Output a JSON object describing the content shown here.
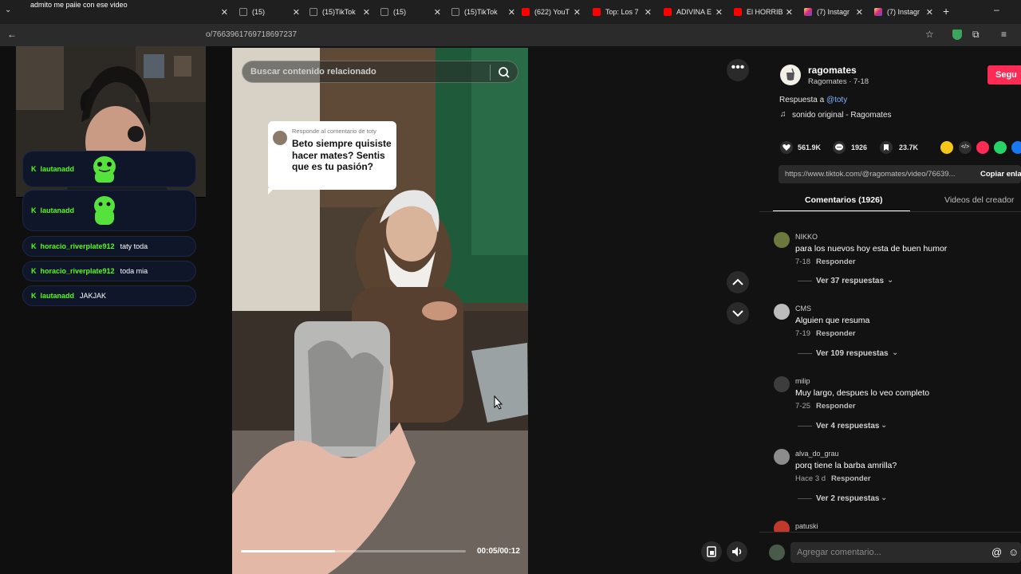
{
  "browser": {
    "top_text": "admito me paiie con ese video",
    "tabs": [
      {
        "label": "",
        "icon": "tiktok-icon"
      },
      {
        "label": "(15)",
        "icon": "tiktok-icon"
      },
      {
        "label": "(15)TikTok",
        "icon": "tiktok-icon"
      },
      {
        "label": "(15)",
        "icon": "tiktok-icon"
      },
      {
        "label": "(15)TikTok",
        "icon": "tiktok-icon"
      },
      {
        "label": "(622) YouT",
        "icon": "youtube-icon"
      },
      {
        "label": "Top: Los 7",
        "icon": "youtube-icon"
      },
      {
        "label": "ADIVINA E",
        "icon": "youtube-icon"
      },
      {
        "label": "El HORRIB",
        "icon": "youtube-icon"
      },
      {
        "label": "(7) Instagr",
        "icon": "instagram-icon"
      },
      {
        "label": "(7) Instagr",
        "icon": "instagram-icon"
      }
    ],
    "url": "o/7663961769718697237",
    "new_tab": "+",
    "minimize": "–"
  },
  "chat": [
    {
      "user": "lautanadd",
      "message": "",
      "emote": "green-emote"
    },
    {
      "user": "lautanadd",
      "message": "",
      "emote": "green-emote"
    },
    {
      "user": "horacio_riverplate912",
      "message": "taty toda"
    },
    {
      "user": "horacio_riverplate912",
      "message": "toda mia"
    },
    {
      "user": "lautanadd",
      "message": "JAKJAK"
    }
  ],
  "video": {
    "search_placeholder": "Buscar contenido relacionado",
    "reply_header": "Responde al comentario de toty",
    "reply_text": "Beto siempre quisiste hacer mates? Sentis que es tu pasión?",
    "time": "00:05/00:12",
    "progress": 0.42
  },
  "creator": {
    "username": "ragomates",
    "display": "Ragomates · 7-18",
    "follow": "Segu",
    "reply_prefix": "Respuesta a ",
    "reply_to": "@toty",
    "sound": "sonido original - Ragomates",
    "likes": "561.9K",
    "comments": "1926",
    "saves": "23.7K",
    "link": "https://www.tiktok.com/@ragomates/video/76639...",
    "copy": "Copiar enla"
  },
  "tabs": {
    "comments": "Comentarios (1926)",
    "videos": "Videos del creador"
  },
  "comments": [
    {
      "name": "NIKKO",
      "text": "para los nuevos hoy esta de buen humor",
      "date": "7-18",
      "reply": "Responder",
      "more": "Ver 37 respuestas"
    },
    {
      "name": "CMS",
      "text": "Alguien que resuma",
      "date": "7-19",
      "reply": "Responder",
      "more": "Ver 109 respuestas"
    },
    {
      "name": "milip",
      "text": "Muy largo, despues lo veo completo",
      "date": "7-25",
      "reply": "Responder",
      "more": "Ver 4 respuestas"
    },
    {
      "name": "alva_do_grau",
      "text": "porq tiene la barba amrilla?",
      "date": "Hace 3 d",
      "reply": "Responder",
      "more": "Ver 2 respuestas"
    },
    {
      "name": "patuski",
      "text": "",
      "date": "",
      "reply": "",
      "more": ""
    }
  ],
  "composer": {
    "placeholder": "Agregar comentario...",
    "at": "@"
  },
  "colors": {
    "accent": "#fe2c55",
    "link": "#7ab6ff",
    "kick_green": "#53fc18"
  }
}
